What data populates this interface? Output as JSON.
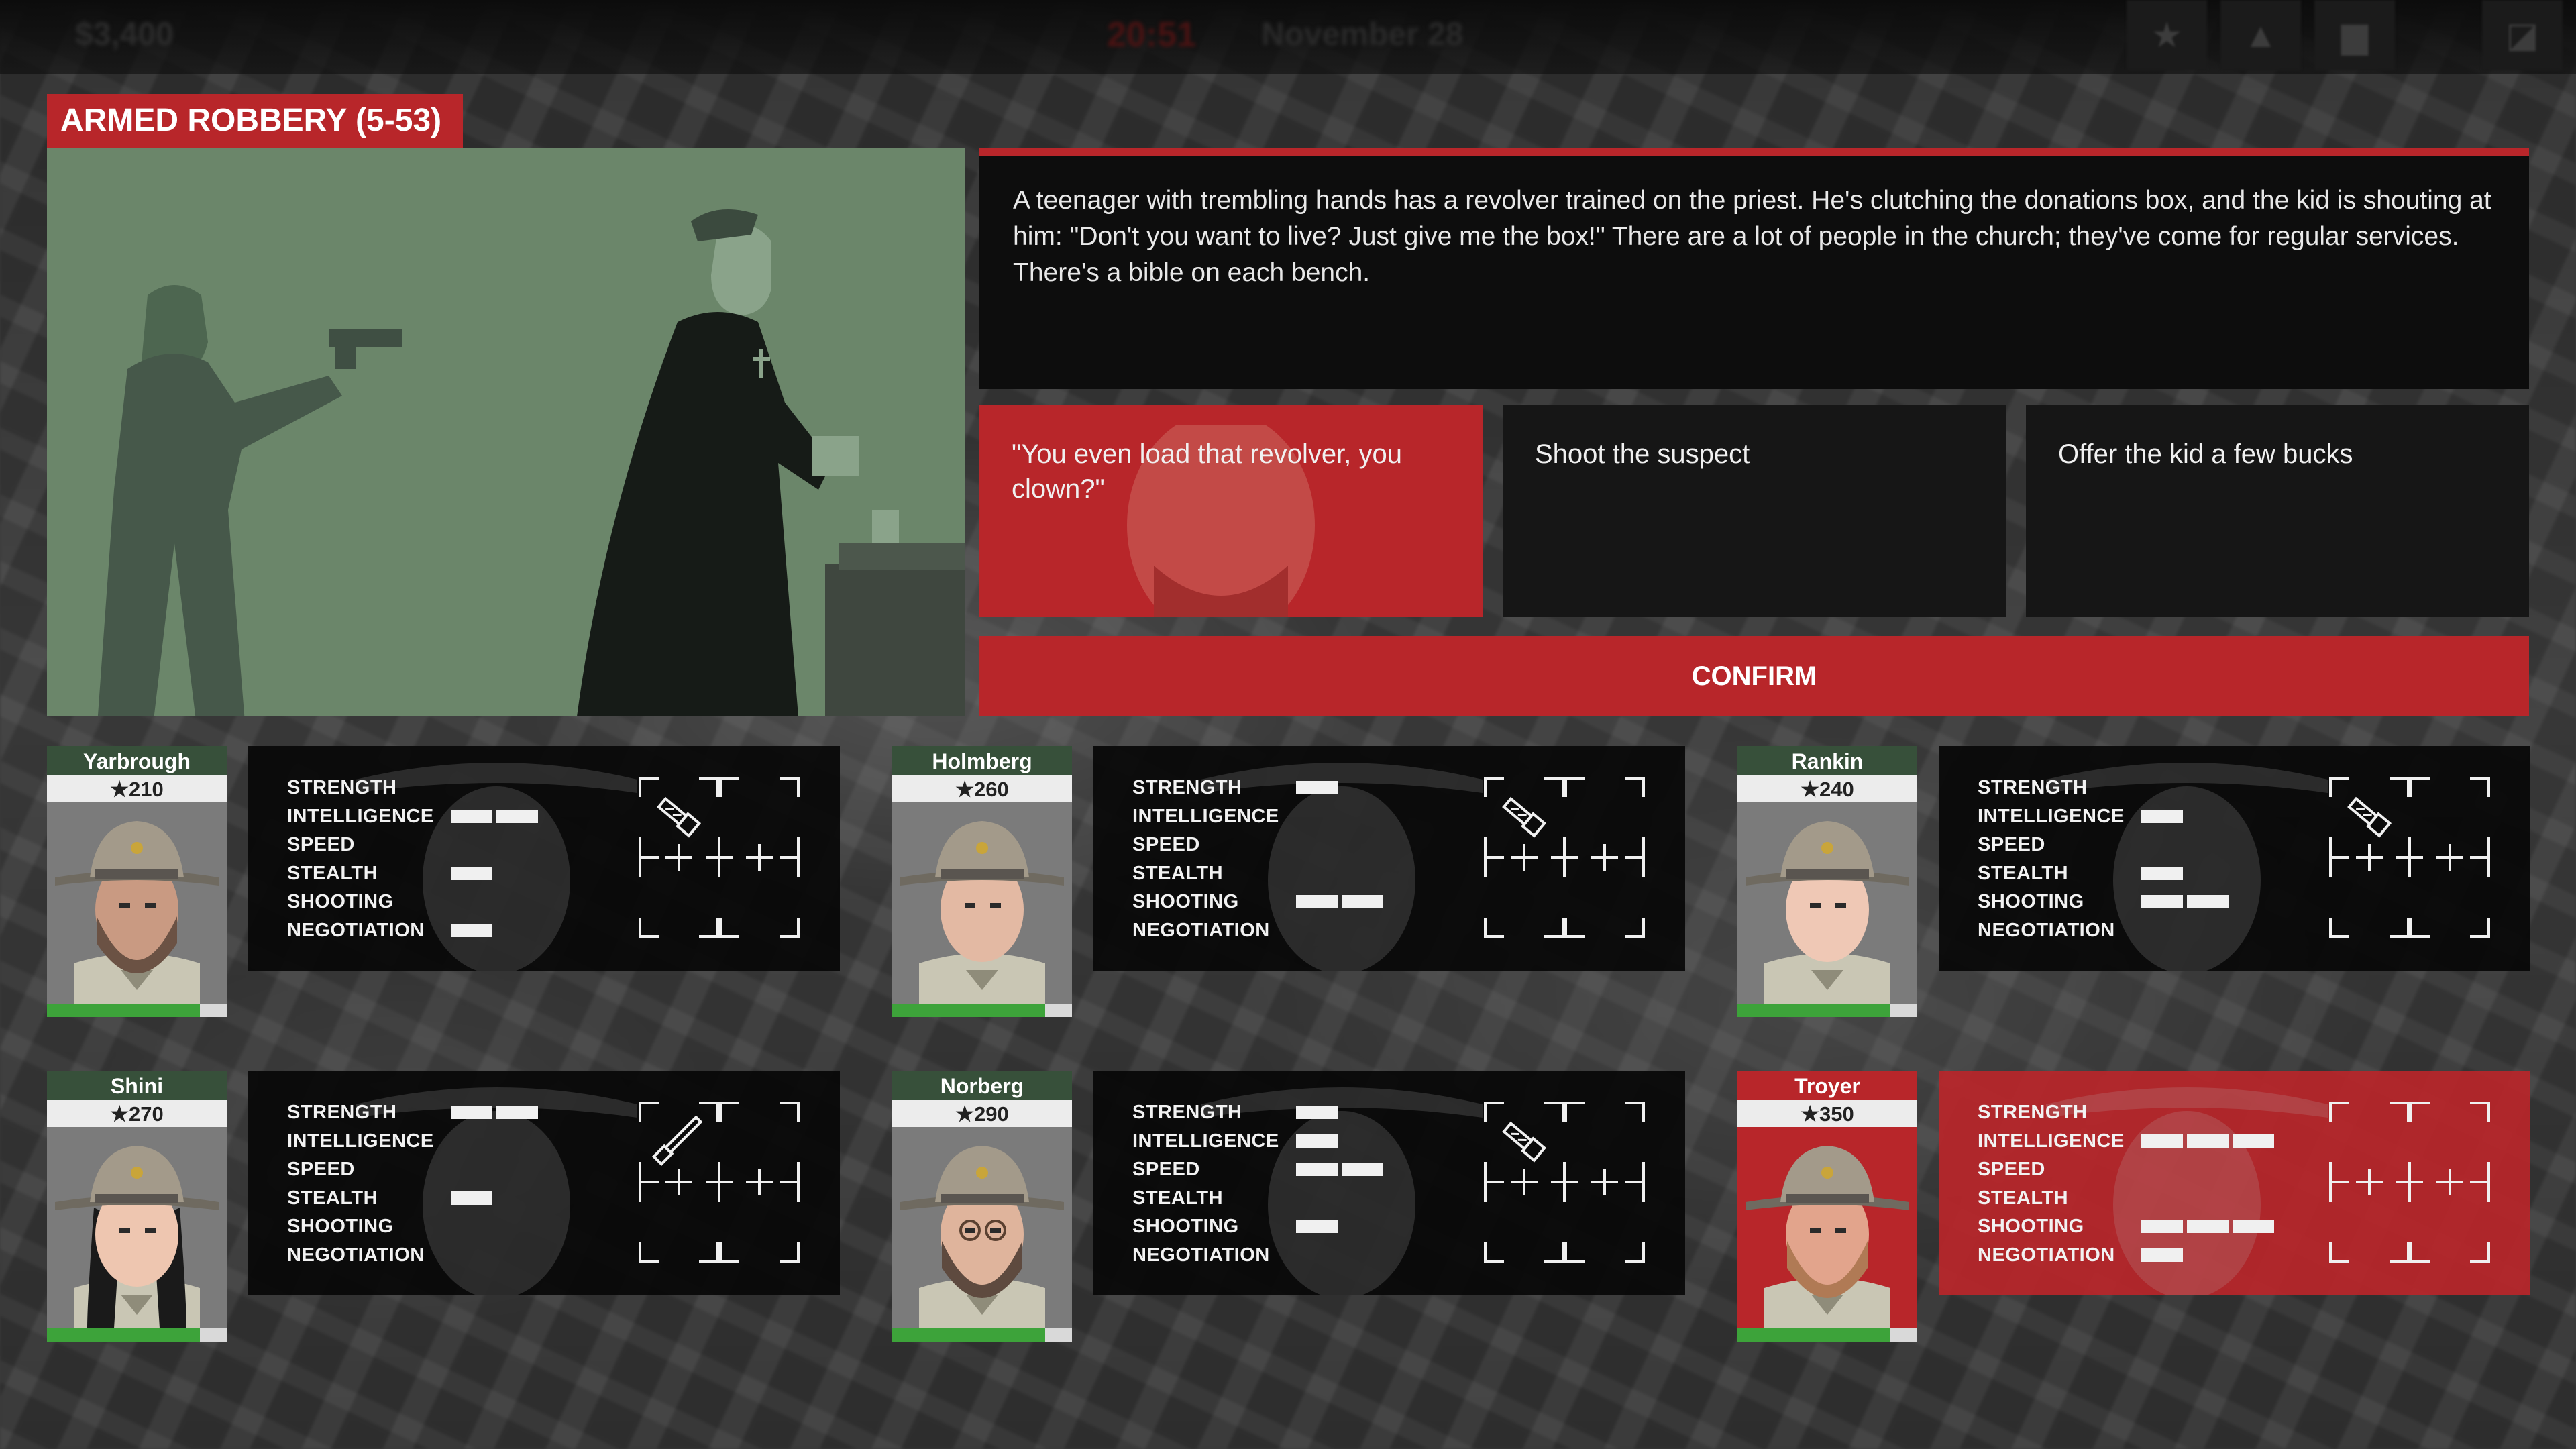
{
  "hud": {
    "money": "$3,400",
    "clock": "20:51",
    "date": "November 28",
    "buttons": [
      "star-icon",
      "officer-icon",
      "archive-icon",
      "menu-icon"
    ]
  },
  "incident": {
    "title": "ARMED ROBBERY (5-53)",
    "description": "A teenager with trembling hands has a revolver trained on the priest. He's clutching the donations box, and the kid is shouting at him: \"Don't you want to live? Just give me the box!\" There are a lot of people in the church; they've come for regular services. There's a bible on each bench.",
    "options": [
      {
        "label": "\"You even load that revolver, you clown?\"",
        "selected": true
      },
      {
        "label": "Shoot the suspect",
        "selected": false
      },
      {
        "label": "Offer the kid a few bucks",
        "selected": false
      }
    ],
    "confirm_label": "CONFIRM"
  },
  "stat_labels": [
    "STRENGTH",
    "INTELLIGENCE",
    "SPEED",
    "STEALTH",
    "SHOOTING",
    "NEGOTIATION"
  ],
  "officers": [
    {
      "name": "Yarbrough",
      "rank": "★210",
      "health": 0.85,
      "selected": false,
      "stats": [
        0,
        2,
        0,
        1,
        0,
        1
      ],
      "item": "taser"
    },
    {
      "name": "Holmberg",
      "rank": "★260",
      "health": 0.85,
      "selected": false,
      "stats": [
        1,
        0,
        0,
        0,
        2,
        0
      ],
      "item": "taser"
    },
    {
      "name": "Rankin",
      "rank": "★240",
      "health": 0.85,
      "selected": false,
      "stats": [
        0,
        1,
        0,
        1,
        2,
        0
      ],
      "item": "taser"
    },
    {
      "name": "Shini",
      "rank": "★270",
      "health": 0.85,
      "selected": false,
      "stats": [
        2,
        0,
        0,
        1,
        0,
        0
      ],
      "item": "baton"
    },
    {
      "name": "Norberg",
      "rank": "★290",
      "health": 0.85,
      "selected": false,
      "stats": [
        1,
        1,
        2,
        0,
        1,
        0
      ],
      "item": "taser"
    },
    {
      "name": "Troyer",
      "rank": "★350",
      "health": 0.85,
      "selected": true,
      "stats": [
        0,
        3,
        0,
        0,
        3,
        1
      ],
      "item": ""
    }
  ],
  "colors": {
    "accent": "#b8262a",
    "scene_bg": "#6b866a",
    "health": "#3da33a",
    "panel": "#0d0d0d"
  }
}
